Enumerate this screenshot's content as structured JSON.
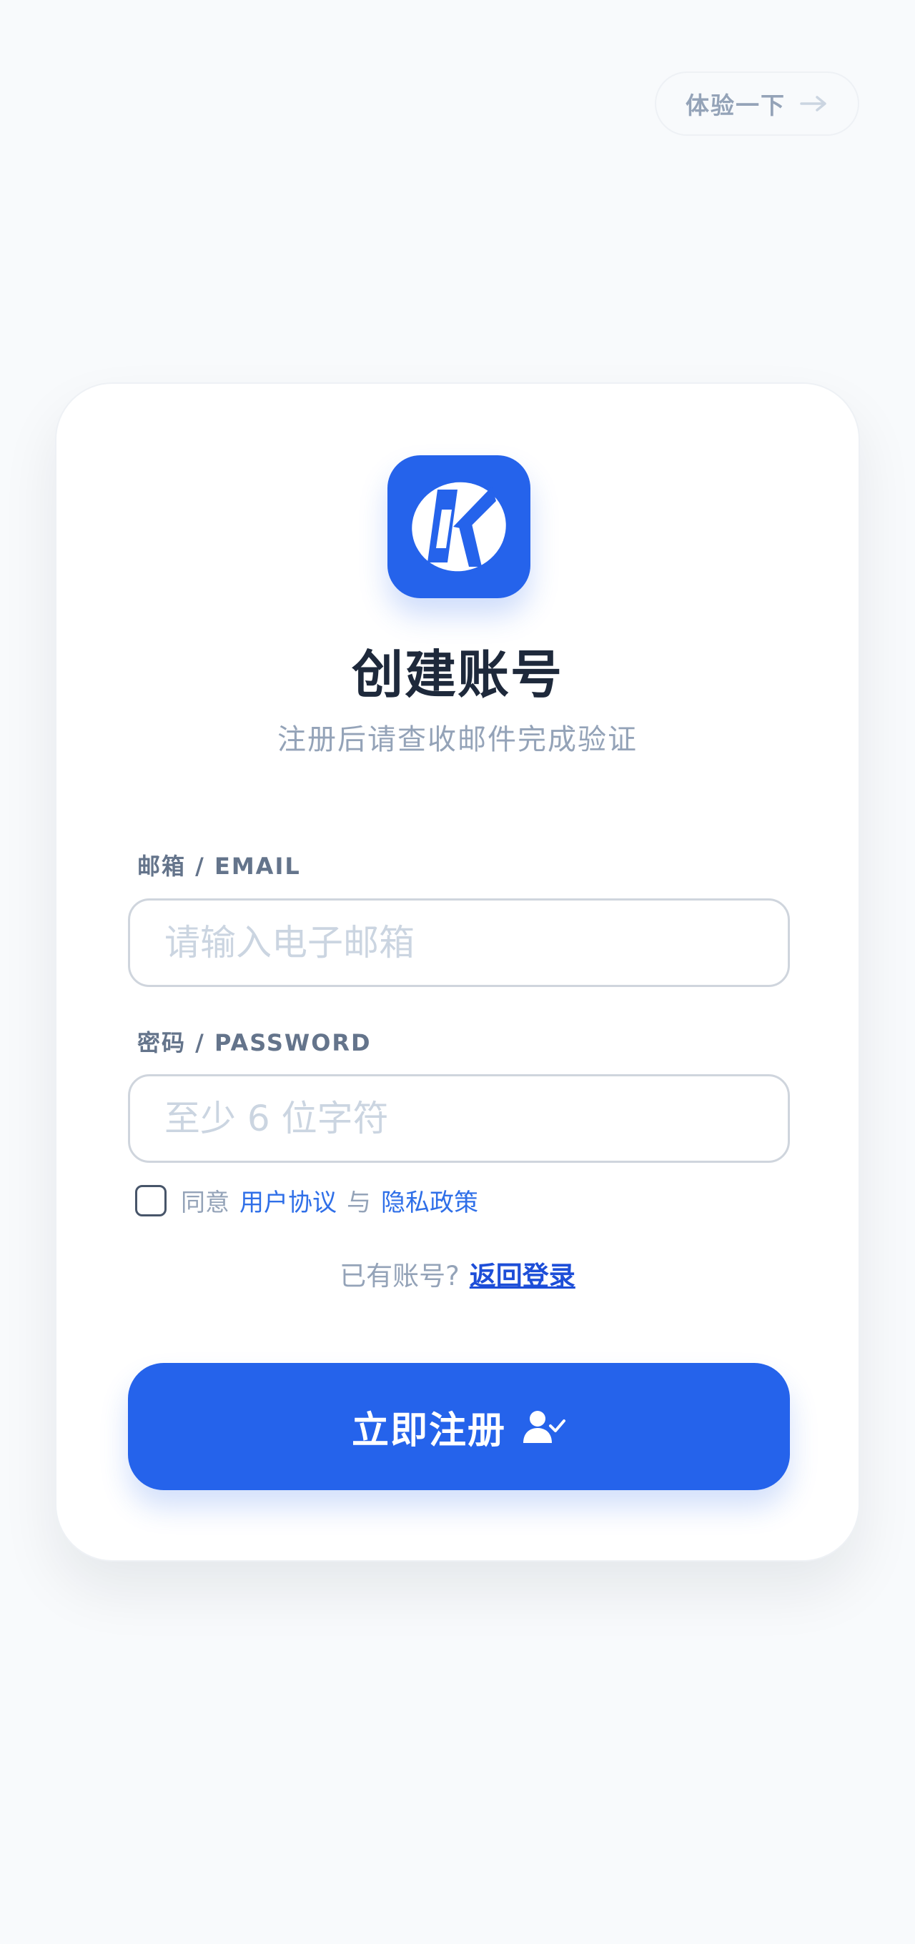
{
  "top_button": {
    "label": "体验一下",
    "icon": "arrow-right-icon"
  },
  "card": {
    "title": "创建账号",
    "subtitle": "注册后请查收邮件完成验证",
    "logo_icon": "k-logo-icon",
    "email": {
      "label": "邮箱 / EMAIL",
      "placeholder": "请输入电子邮箱",
      "value": ""
    },
    "password": {
      "label": "密码 / PASSWORD",
      "placeholder": "至少 6 位字符",
      "value": ""
    },
    "agreement": {
      "prefix": "同意",
      "terms_link": "用户协议",
      "conjunction": "与",
      "privacy_link": "隐私政策",
      "checked": false
    },
    "login_prompt": {
      "text": "已有账号?",
      "link": "返回登录"
    },
    "register_button": {
      "label": "立即注册",
      "icon": "user-check-icon"
    }
  },
  "colors": {
    "primary": "#2563eb",
    "background": "#f8fafc",
    "title": "#1e293b",
    "muted": "#94a3b8",
    "link": "#2f6fe8"
  }
}
